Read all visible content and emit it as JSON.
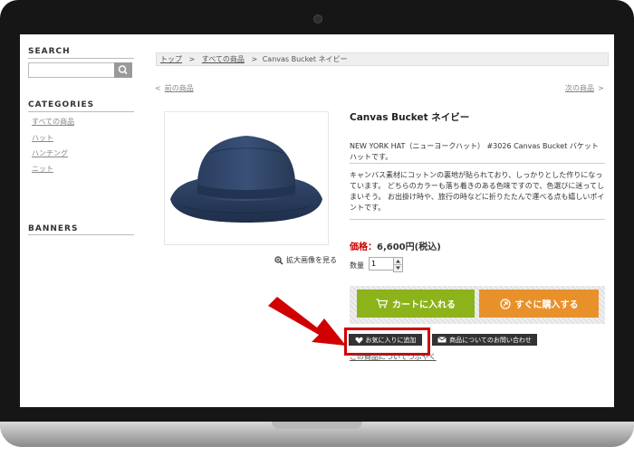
{
  "sidebar": {
    "search_heading": "SEARCH",
    "search_value": "",
    "categories_heading": "CATEGORIES",
    "categories": [
      "すべての商品",
      "ハット",
      "ハンチング",
      "ニット"
    ],
    "banners_heading": "BANNERS"
  },
  "breadcrumb": {
    "items": [
      "トップ",
      "すべての商品",
      "Canvas Bucket ネイビー"
    ],
    "separator": ">"
  },
  "nav": {
    "prev_arrow": "<",
    "prev": "前の商品",
    "next": "次の商品",
    "next_arrow": ">"
  },
  "product": {
    "image_alt": "navy bucket hat",
    "zoom_label": "拡大画像を見る",
    "title": "Canvas Bucket ネイビー",
    "description_1": "NEW YORK HAT（ニューヨークハット） #3026 Canvas Bucket バケットハットです。",
    "description_2": "キャンバス素材にコットンの裏地が貼られており、しっかりとした作りになっています。 どちらのカラーも落ち着きのある色味ですので、色選びに迷ってしまいそう。 お出掛け時や、旅行の時などに折りたたんで運べる点も嬉しいポイントです。",
    "price_label": "価格：",
    "price": "6,600円(税込)",
    "qty_label": "数量",
    "qty_value": "1"
  },
  "actions": {
    "add_to_cart": "カートに入れる",
    "buy_now": "すぐに購入する",
    "add_favorite": "お気に入りに追加",
    "contact": "商品についてのお問い合わせ",
    "tweet": "この商品についてつぶやく"
  },
  "colors": {
    "cart_button": "#8cb31a",
    "buy_button": "#e8912b",
    "price_label": "#cc0000",
    "highlight": "#d10000",
    "hat": "#2b3f5f"
  },
  "icons": [
    "search-icon",
    "cart-icon",
    "circle-arrow-icon",
    "heart-icon",
    "mail-icon",
    "magnifier-plus-icon",
    "red-arrow-icon"
  ]
}
